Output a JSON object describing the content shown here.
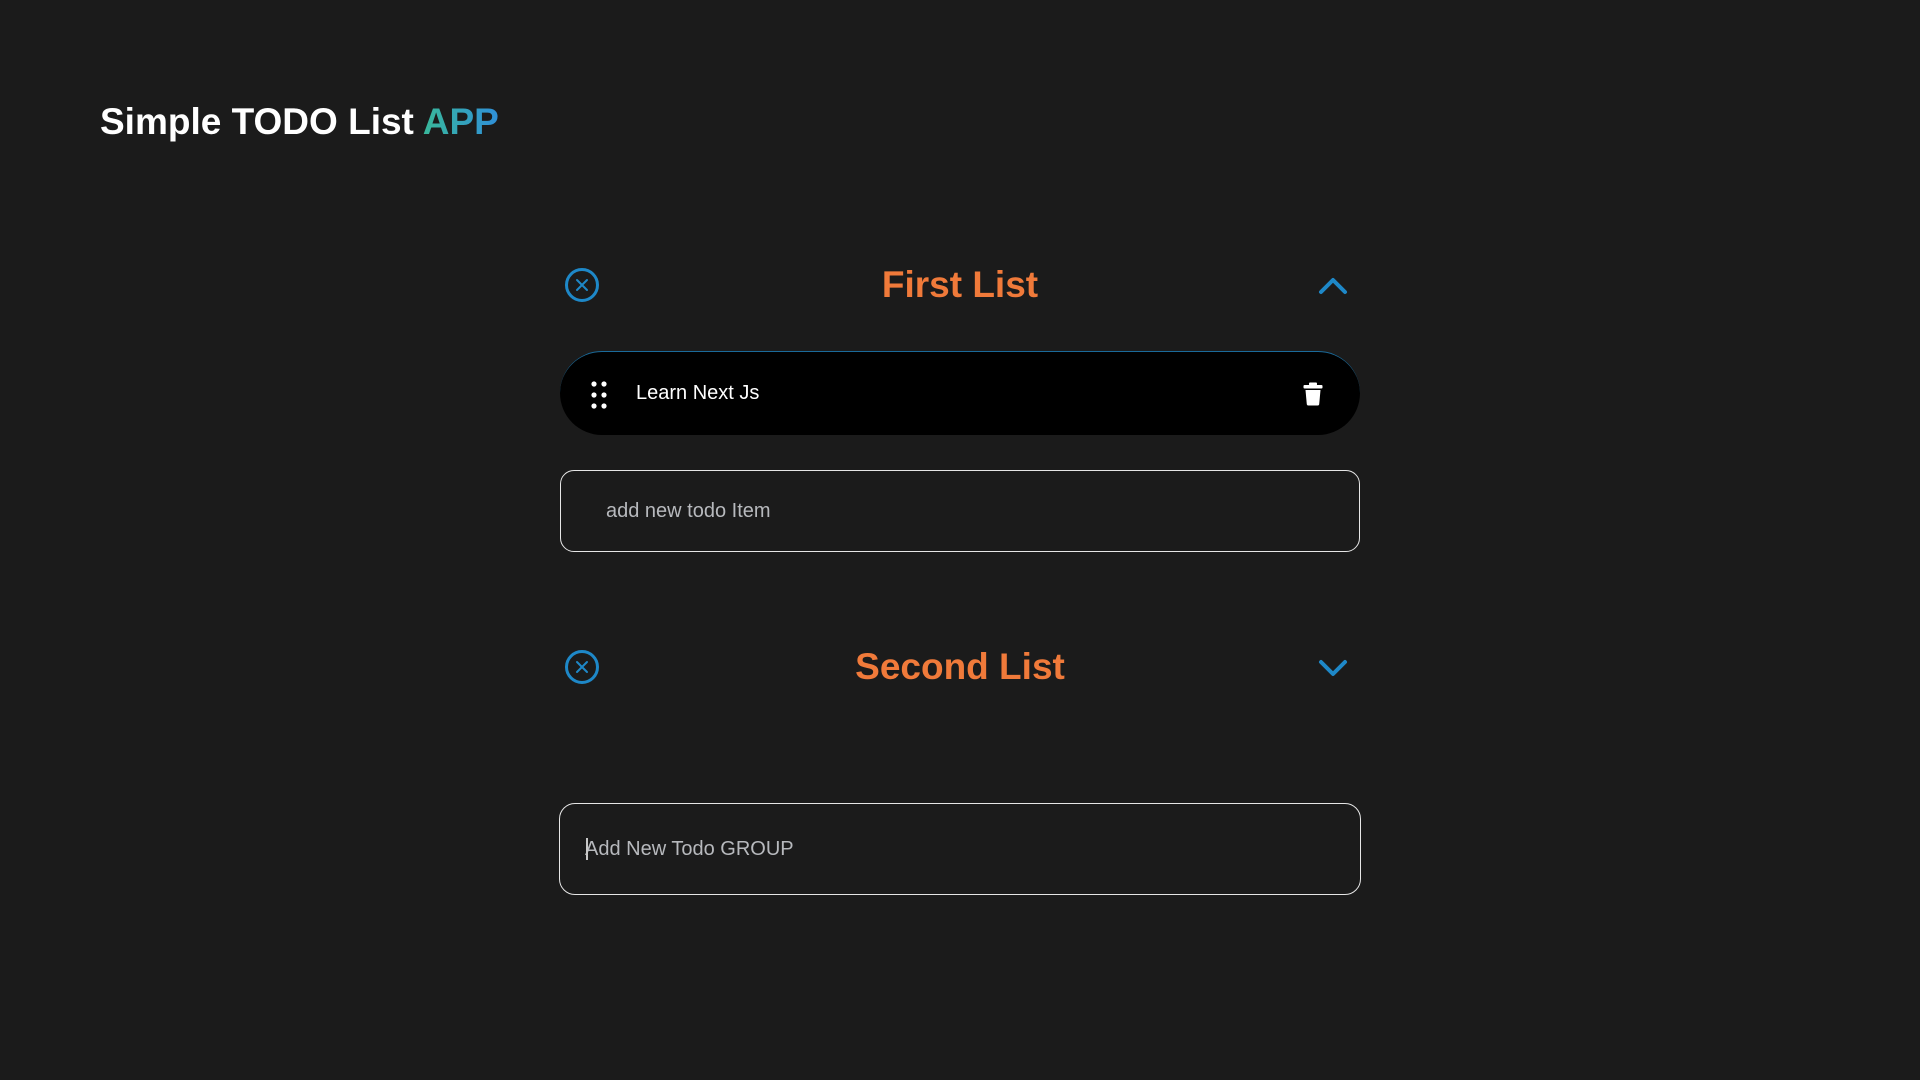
{
  "app": {
    "title_main": "Simple TODO List ",
    "title_accent": "APP"
  },
  "colors": {
    "background": "#1b1b1b",
    "group_title": "#f07a3a",
    "icon_accent": "#1e88c8",
    "accent_gradient_start": "#39b89a",
    "accent_gradient_end": "#2f8fd9"
  },
  "groups": [
    {
      "title": "First List",
      "expanded": true,
      "remove_icon": "circle-x-icon",
      "toggle_icon": "chevron-up-icon",
      "items": [
        {
          "text": "Learn Next Js",
          "handle_icon": "drag-dots-icon",
          "delete_icon": "trash-icon"
        }
      ],
      "new_item_placeholder": "add new todo Item",
      "new_item_value": ""
    },
    {
      "title": "Second List",
      "expanded": false,
      "remove_icon": "circle-x-icon",
      "toggle_icon": "chevron-down-icon",
      "items": []
    }
  ],
  "new_group": {
    "placeholder": "Add New Todo GROUP",
    "value": ""
  }
}
